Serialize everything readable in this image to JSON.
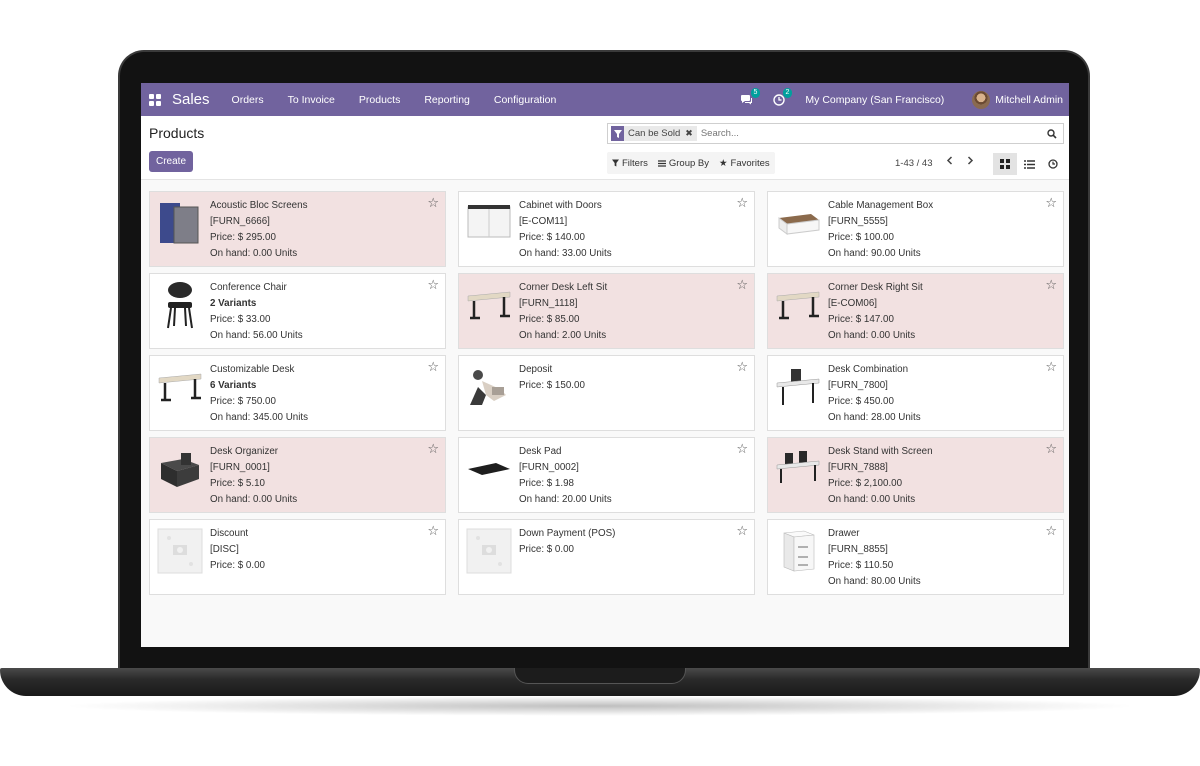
{
  "app": {
    "name": "Sales",
    "menu": [
      "Orders",
      "To Invoice",
      "Products",
      "Reporting",
      "Configuration"
    ],
    "messages_count": "5",
    "activities_count": "2",
    "company": "My Company (San Francisco)",
    "user": "Mitchell Admin",
    "accent_color": "#71639e"
  },
  "page": {
    "title": "Products",
    "create_label": "Create",
    "search": {
      "facet": "Can be Sold",
      "placeholder": "Search..."
    },
    "filters_label": "Filters",
    "groupby_label": "Group By",
    "favorites_label": "Favorites",
    "pager": "1-43 / 43"
  },
  "products": [
    {
      "name": "Acoustic Bloc Screens",
      "line1": "[FURN_6666]",
      "price": "Price: $ 295.00",
      "onhand": "On hand: 0.00 Units",
      "low_stock": true,
      "icon": "acoustic-screen-icon"
    },
    {
      "name": "Cabinet with Doors",
      "line1": "[E-COM11]",
      "price": "Price: $ 140.00",
      "onhand": "On hand: 33.00 Units",
      "low_stock": false,
      "icon": "cabinet-icon"
    },
    {
      "name": "Cable Management Box",
      "line1": "[FURN_5555]",
      "price": "Price: $ 100.00",
      "onhand": "On hand: 90.00 Units",
      "low_stock": false,
      "icon": "cable-box-icon"
    },
    {
      "name": "Conference Chair",
      "line1": "2 Variants",
      "price": "Price: $ 33.00",
      "onhand": "On hand: 56.00 Units",
      "low_stock": false,
      "icon": "chair-icon"
    },
    {
      "name": "Corner Desk Left Sit",
      "line1": "[FURN_1118]",
      "price": "Price: $ 85.00",
      "onhand": "On hand: 2.00 Units",
      "low_stock": true,
      "icon": "desk-icon"
    },
    {
      "name": "Corner Desk Right Sit",
      "line1": "[E-COM06]",
      "price": "Price: $ 147.00",
      "onhand": "On hand: 0.00 Units",
      "low_stock": true,
      "icon": "desk-icon"
    },
    {
      "name": "Customizable Desk",
      "line1": "6 Variants",
      "price": "Price: $ 750.00",
      "onhand": "On hand: 345.00 Units",
      "low_stock": false,
      "icon": "desk-icon"
    },
    {
      "name": "Deposit",
      "line1": "",
      "price": "Price: $ 150.00",
      "onhand": "",
      "low_stock": false,
      "icon": "deposit-icon"
    },
    {
      "name": "Desk Combination",
      "line1": "[FURN_7800]",
      "price": "Price: $ 450.00",
      "onhand": "On hand: 28.00 Units",
      "low_stock": false,
      "icon": "desk-combination-icon"
    },
    {
      "name": "Desk Organizer",
      "line1": "[FURN_0001]",
      "price": "Price: $ 5.10",
      "onhand": "On hand: 0.00 Units",
      "low_stock": true,
      "icon": "organizer-icon"
    },
    {
      "name": "Desk Pad",
      "line1": "[FURN_0002]",
      "price": "Price: $ 1.98",
      "onhand": "On hand: 20.00 Units",
      "low_stock": false,
      "icon": "desk-pad-icon"
    },
    {
      "name": "Desk Stand with Screen",
      "line1": "[FURN_7888]",
      "price": "Price: $ 2,100.00",
      "onhand": "On hand: 0.00 Units",
      "low_stock": true,
      "icon": "desk-stand-icon"
    },
    {
      "name": "Discount",
      "line1": "[DISC]",
      "price": "Price: $ 0.00",
      "onhand": "",
      "low_stock": false,
      "icon": "placeholder-image-icon"
    },
    {
      "name": "Down Payment (POS)",
      "line1": "",
      "price": "Price: $ 0.00",
      "onhand": "",
      "low_stock": false,
      "icon": "placeholder-image-icon"
    },
    {
      "name": "Drawer",
      "line1": "[FURN_8855]",
      "price": "Price: $ 110.50",
      "onhand": "On hand: 80.00 Units",
      "low_stock": false,
      "icon": "drawer-icon"
    }
  ]
}
